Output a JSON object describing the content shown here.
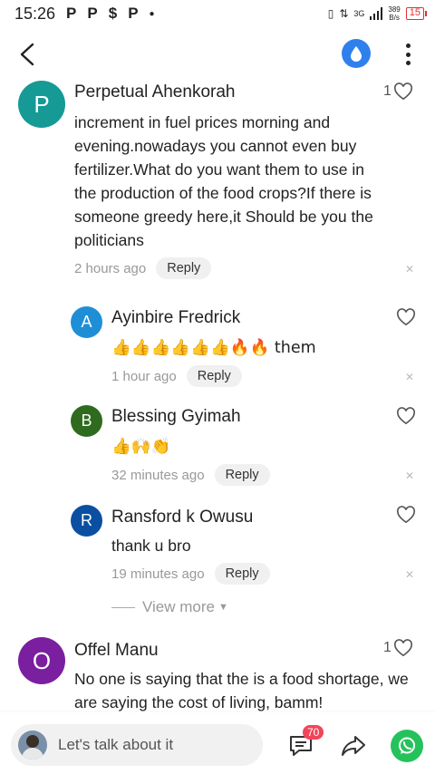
{
  "status": {
    "time": "15:26",
    "apps": [
      "P",
      "P",
      "$",
      "P"
    ],
    "network": "3G",
    "speed_value": "389",
    "speed_unit": "B/s",
    "battery": "15"
  },
  "comments": [
    {
      "initial": "P",
      "avatar_color": "#159a96",
      "author": "Perpetual Ahenkorah",
      "likes": "1",
      "text": "increment in fuel prices morning and evening.nowadays you cannot even buy fertilizer.What do you want them to use in the production of the food crops?If there is someone greedy here,it Should be you the politicians",
      "time": "2 hours ago",
      "reply_label": "Reply"
    },
    {
      "initial": "A",
      "avatar_color": "#1e8fd6",
      "author": "Ayinbire Fredrick",
      "text": "👍👍👍👍👍👍🔥🔥 them",
      "time": "1 hour ago",
      "reply_label": "Reply"
    },
    {
      "initial": "B",
      "avatar_color": "#2e6b1e",
      "author": "Blessing Gyimah",
      "text": "👍🙌👏",
      "time": "32 minutes ago",
      "reply_label": "Reply"
    },
    {
      "initial": "R",
      "avatar_color": "#0b4fa0",
      "author": "Ransford k Owusu",
      "text": "thank u bro",
      "time": "19 minutes ago",
      "reply_label": "Reply"
    },
    {
      "initial": "O",
      "avatar_color": "#7a1fa0",
      "author": "Offel Manu",
      "likes": "1",
      "text": "No one is saying that the is a food shortage, we are saying the cost of living, bamm!"
    }
  ],
  "view_more": "View more",
  "input": {
    "placeholder": "Let's talk about it"
  },
  "comment_count_badge": "70",
  "colors": {
    "accent_blue": "#2f80ed",
    "whatsapp_green": "#25c25b",
    "badge_red": "#f0465a"
  }
}
